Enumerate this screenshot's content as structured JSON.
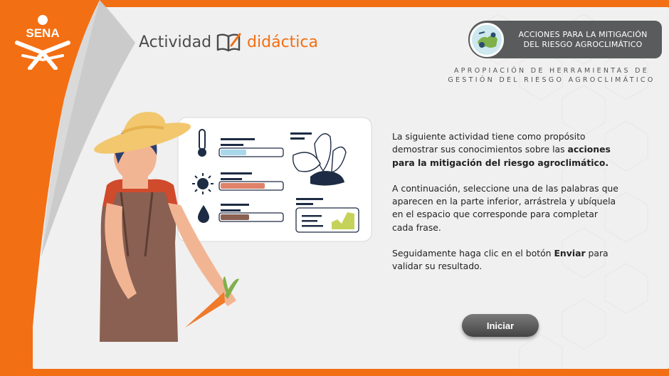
{
  "header": {
    "logo_text": "SENA",
    "brand_word1": "Actividad",
    "brand_word2": "didáctica",
    "badge_line1": "ACCIONES PARA LA MITIGACIÓN",
    "badge_line2": "DEL RIESGO AGROCLIMÁTICO",
    "subtitle_line1": "APROPIACIÓN DE HERRAMIENTAS DE",
    "subtitle_line2": "GESTIÓN DEL RIESGO AGROCLIMÁTICO"
  },
  "instructions": {
    "p1_text": "La siguiente actividad tiene como propósito demostrar sus conocimientos sobre las ",
    "p1_bold": "acciones para la mitigación del riesgo agroclimático.",
    "p2_text": "A continuación, seleccione una de las palabras que aparecen en la parte inferior, arrástrela y ubíquela en el espacio que corresponde para completar cada frase.",
    "p3_text": "Seguidamente haga clic en el botón ",
    "p3_bold": "Enviar",
    "p3_end": " para validar su resultado."
  },
  "start_button": {
    "label": "Iniciar"
  },
  "colors": {
    "brand_orange": "#f36f13",
    "badge_gray": "#5a5b5c",
    "button_gray": "#555555"
  }
}
